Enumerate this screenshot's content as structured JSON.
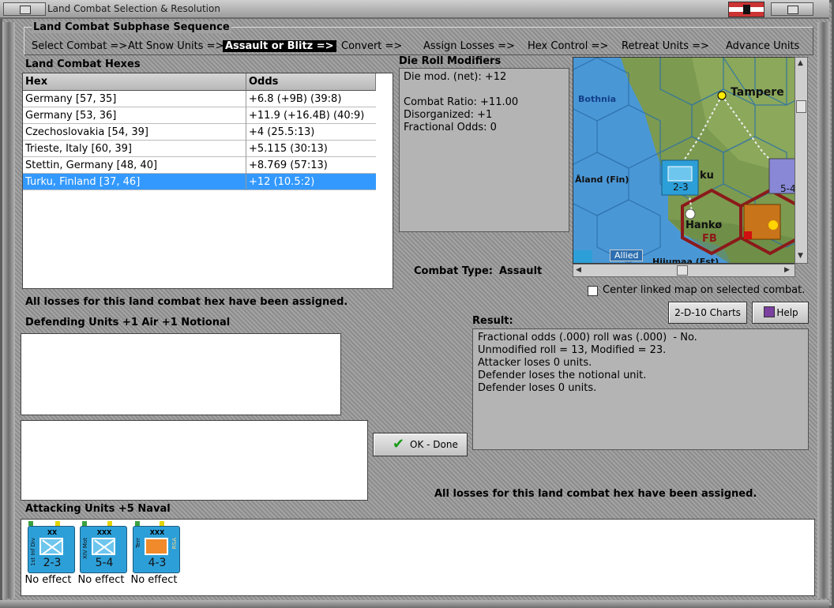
{
  "window": {
    "title": "Land Combat Selection & Resolution"
  },
  "sequence": {
    "title": "Land Combat Subphase Sequence",
    "steps": [
      "Select Combat =>",
      "Att Snow Units =>",
      "Assault or Blitz =>",
      "Convert =>",
      "Assign Losses =>",
      "Hex Control =>",
      "Retreat Units =>",
      "Advance Units"
    ]
  },
  "hexes": {
    "title": "Land Combat Hexes",
    "columns": [
      "Hex",
      "Odds"
    ],
    "rows": [
      {
        "hex": "Germany [57, 35]",
        "odds": "+6.8 (+9B) (39:8)"
      },
      {
        "hex": "Germany [53, 36]",
        "odds": "+11.9 (+16.4B) (40:9)"
      },
      {
        "hex": "Czechoslovakia [54, 39]",
        "odds": "+4 (25.5:13)"
      },
      {
        "hex": "Trieste, Italy [60, 39]",
        "odds": "+5.115 (30:13)"
      },
      {
        "hex": "Stettin, Germany [48, 40]",
        "odds": "+8.769 (57:13)"
      },
      {
        "hex": "Turku, Finland [37, 46]",
        "odds": "+12 (10.5:2)"
      }
    ]
  },
  "modifiers": {
    "title": "Die Roll Modifiers",
    "lines": [
      "Die mod. (net): +12",
      "",
      "Combat Ratio: +11.00",
      "Disorganized: +1",
      "Fractional Odds: 0"
    ]
  },
  "combat_type": {
    "label": "Combat Type:",
    "value": "Assault"
  },
  "map": {
    "labels": [
      "Bothnia",
      "Tampere",
      "Åland (Fin)",
      "Hankø",
      "FB",
      "Allied",
      "Hiiumaa (Est)",
      "ku"
    ],
    "center_label": "Center linked map on selected combat."
  },
  "status_top": "All losses for this land combat hex have been assigned.",
  "defending": {
    "title": "Defending Units +1 Air +1 Notional"
  },
  "buttons": {
    "charts": "2-D-10 Charts",
    "help": "Help",
    "ok": "OK - Done"
  },
  "result": {
    "title": "Result:",
    "lines": [
      "Fractional odds (.000) roll was (.000)  - No.",
      "Unmodified roll = 13, Modified = 23.",
      "Attacker loses 0 units.",
      "Defender loses the notional unit.",
      "Defender loses 0 units."
    ]
  },
  "status_bottom": "All losses for this land combat hex have been assigned.",
  "attacking": {
    "title": "Attacking Units +5 Naval",
    "units": [
      {
        "size": "XX",
        "strength": "2-3",
        "side": "1st Inf Div",
        "effect": "No effect",
        "type": "infantry"
      },
      {
        "size": "XXX",
        "strength": "5-4",
        "side": "XIV Mot",
        "effect": "No effect",
        "type": "motorized"
      },
      {
        "size": "XXX",
        "strength": "4-3",
        "side": "Terr",
        "side2": "RSA",
        "effect": "No effect",
        "type": "territorial"
      }
    ]
  },
  "colors": {
    "selected_row": "#3399ff",
    "unit_blue": "#2d9fd8",
    "hex_border": "#8b1a1a"
  }
}
